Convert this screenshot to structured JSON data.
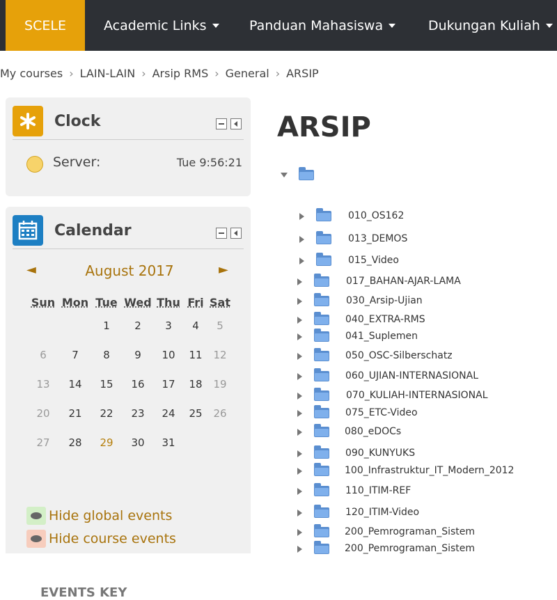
{
  "nav": {
    "brand": "SCELE",
    "links": [
      "Academic Links",
      "Panduan Mahasiswa",
      "Dukungan Kuliah"
    ]
  },
  "breadcrumb": [
    "My courses",
    "LAIN-LAIN",
    "Arsip RMS",
    "General",
    "ARSIP"
  ],
  "clock": {
    "title": "Clock",
    "server_label": "Server:",
    "server_time": "Tue 9:56:21"
  },
  "calendar": {
    "title": "Calendar",
    "prev": "◄",
    "next": "►",
    "month": "August 2017",
    "weekdays": [
      "Sun",
      "Mon",
      "Tue",
      "Wed",
      "Thu",
      "Fri",
      "Sat"
    ],
    "weeks": [
      [
        "",
        "",
        "1",
        "2",
        "3",
        "4",
        "5"
      ],
      [
        "6",
        "7",
        "8",
        "9",
        "10",
        "11",
        "12"
      ],
      [
        "13",
        "14",
        "15",
        "16",
        "17",
        "18",
        "19"
      ],
      [
        "20",
        "21",
        "22",
        "23",
        "24",
        "25",
        "26"
      ],
      [
        "27",
        "28",
        "29",
        "30",
        "31",
        "",
        ""
      ]
    ],
    "today": "29",
    "events_key": "EVENTS KEY",
    "events": [
      "Hide global events",
      "Hide course events"
    ]
  },
  "main": {
    "title": "ARSIP",
    "folders": [
      "010_OS162",
      "013_DEMOS",
      "015_Video",
      "017_BAHAN-AJAR-LAMA",
      "030_Arsip-Ujian",
      "040_EXTRA-RMS",
      "041_Suplemen",
      "050_OSC-Silberschatz",
      "060_UJIAN-INTERNASIONAL",
      "070_KULIAH-INTERNASIONAL",
      "075_ETC-Video",
      "080_eDOCs",
      "090_KUNYUKS",
      "100_Infrastruktur_IT_Modern_2012",
      "110_ITIM-REF",
      "120_ITIM-Video",
      "200_Pemrograman_Sistem",
      "200_Pemrograman_Sistem"
    ]
  },
  "colors": {
    "nav_bg": "#2d3035",
    "brand_bg": "#e6a10a",
    "accent": "#a8730c",
    "folder": "#5a8ed0"
  }
}
